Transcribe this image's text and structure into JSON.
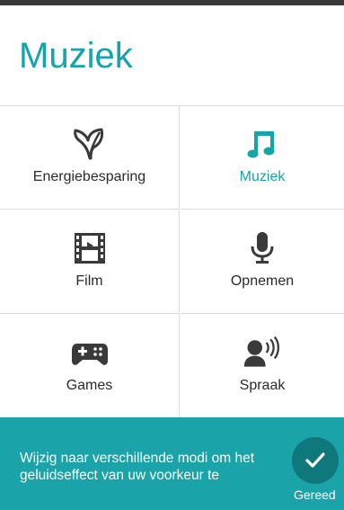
{
  "page": {
    "title": "Muziek"
  },
  "modes": [
    {
      "label": "Energiebesparing",
      "icon": "leaf-icon",
      "active": false
    },
    {
      "label": "Muziek",
      "icon": "music-note-icon",
      "active": true
    },
    {
      "label": "Film",
      "icon": "film-icon",
      "active": false
    },
    {
      "label": "Opnemen",
      "icon": "microphone-icon",
      "active": false
    },
    {
      "label": "Games",
      "icon": "gamepad-icon",
      "active": false
    },
    {
      "label": "Spraak",
      "icon": "speaking-person-icon",
      "active": false
    }
  ],
  "footer": {
    "text": "Wijzig naar verschillende modi om het geluidseffect van uw voorkeur te",
    "done_label": "Gereed"
  },
  "colors": {
    "accent": "#14a4a9",
    "footer_bg": "#1aa3a8",
    "done_button": "#0f787c",
    "icon": "#3a3a3a"
  }
}
